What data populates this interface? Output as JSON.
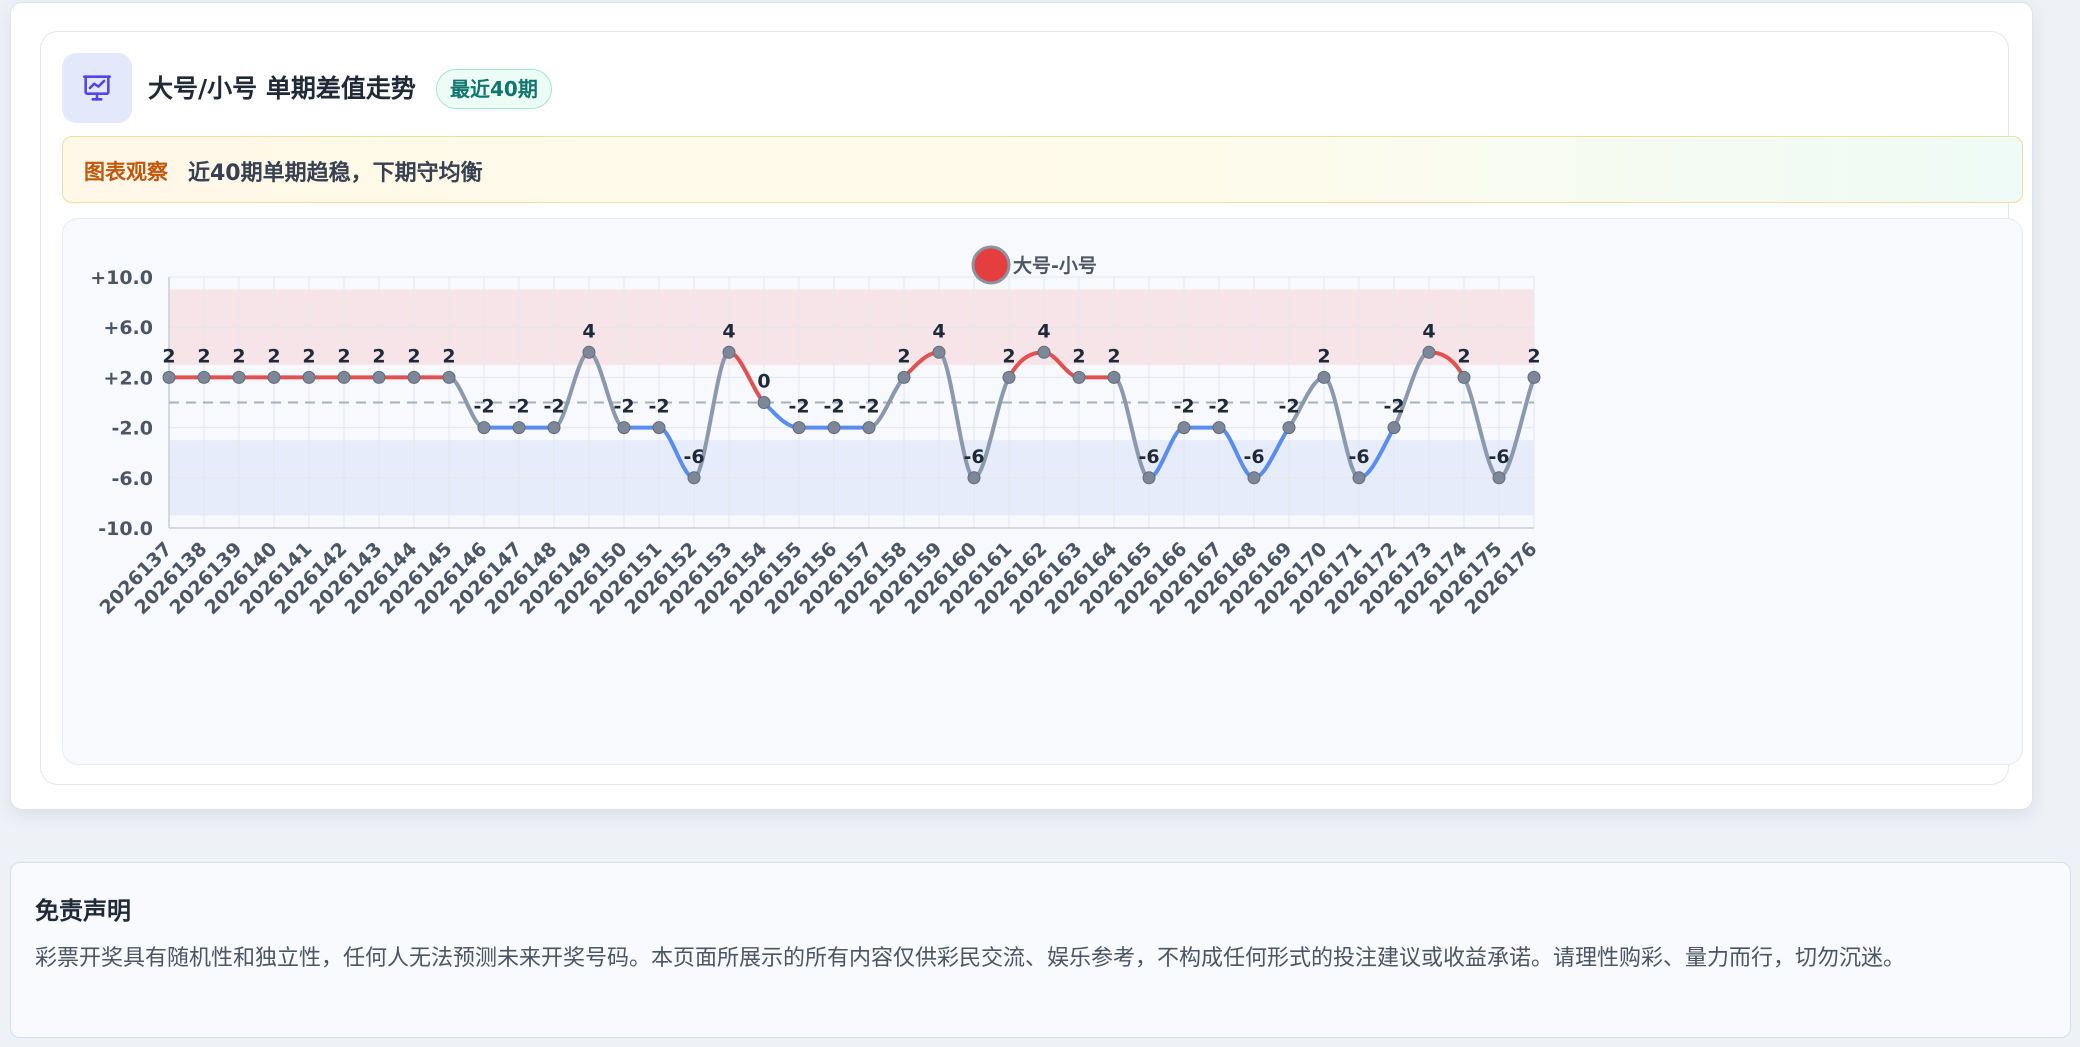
{
  "header": {
    "icon": "presentation-chart-icon",
    "title": "大号/小号 单期差值走势",
    "badge": "最近40期"
  },
  "observation": {
    "label": "图表观察",
    "text": "近40期单期趋稳，下期守均衡"
  },
  "disclaimer": {
    "title": "免责声明",
    "text": "彩票开奖具有随机性和独立性，任何人无法预测未来开奖号码。本页面所展示的所有内容仅供彩民交流、娱乐参考，不构成任何形式的投注建议或收益承诺。请理性购彩、量力而行，切勿沉迷。"
  },
  "colors": {
    "positive": "#e05252",
    "negative": "#5b8def",
    "neutral_line": "#8a99ad",
    "marker": "#7d8797",
    "legend_marker": "#e53e3e",
    "positive_band": "#f7e4e8",
    "negative_band": "#e6ecf9"
  },
  "chart_data": {
    "type": "line",
    "smooth": true,
    "legend": {
      "label": "大号-小号",
      "position": "top-center"
    },
    "x": [
      "2026137",
      "2026138",
      "2026139",
      "2026140",
      "2026141",
      "2026142",
      "2026143",
      "2026144",
      "2026145",
      "2026146",
      "2026147",
      "2026148",
      "2026149",
      "2026150",
      "2026151",
      "2026152",
      "2026153",
      "2026154",
      "2026155",
      "2026156",
      "2026157",
      "2026158",
      "2026159",
      "2026160",
      "2026161",
      "2026162",
      "2026163",
      "2026164",
      "2026165",
      "2026166",
      "2026167",
      "2026168",
      "2026169",
      "2026170",
      "2026171",
      "2026172",
      "2026173",
      "2026174",
      "2026175",
      "2026176"
    ],
    "series": [
      {
        "name": "大号-小号",
        "values": [
          2,
          2,
          2,
          2,
          2,
          2,
          2,
          2,
          2,
          -2,
          -2,
          -2,
          4,
          -2,
          -2,
          -6,
          4,
          0,
          -2,
          -2,
          -2,
          2,
          4,
          -6,
          2,
          4,
          2,
          2,
          -6,
          -2,
          -2,
          -6,
          -2,
          2,
          -6,
          -2,
          4,
          2,
          -6,
          2
        ],
        "data_labels": [
          "2",
          "2",
          "2",
          "2",
          "2",
          "2",
          "2",
          "2",
          "2",
          "-2",
          "-2",
          "-2",
          "4",
          "-2",
          "-2",
          "-6",
          "4",
          "0",
          "-2",
          "-2",
          "-2",
          "2",
          "4",
          "-6",
          "2",
          "4",
          "2",
          "2",
          "-6",
          "-2",
          "-2",
          "-6",
          "-2",
          "2",
          "-6",
          "-2",
          "4",
          "2",
          "-6",
          "2"
        ]
      }
    ],
    "ylim": [
      -10,
      10
    ],
    "yticks": [
      10,
      6,
      2,
      -2,
      -6,
      -10
    ],
    "ytick_labels": [
      "+10.0",
      "+6.0",
      "+2.0",
      "-2.0",
      "-6.0",
      "-10.0"
    ],
    "reference_line": 0,
    "bands": [
      {
        "from": 3,
        "to": 9,
        "color": "#f7e4e8"
      },
      {
        "from": -9,
        "to": -3,
        "color": "#e6ecf9"
      }
    ],
    "grid": true,
    "xlabel": "",
    "ylabel": ""
  }
}
